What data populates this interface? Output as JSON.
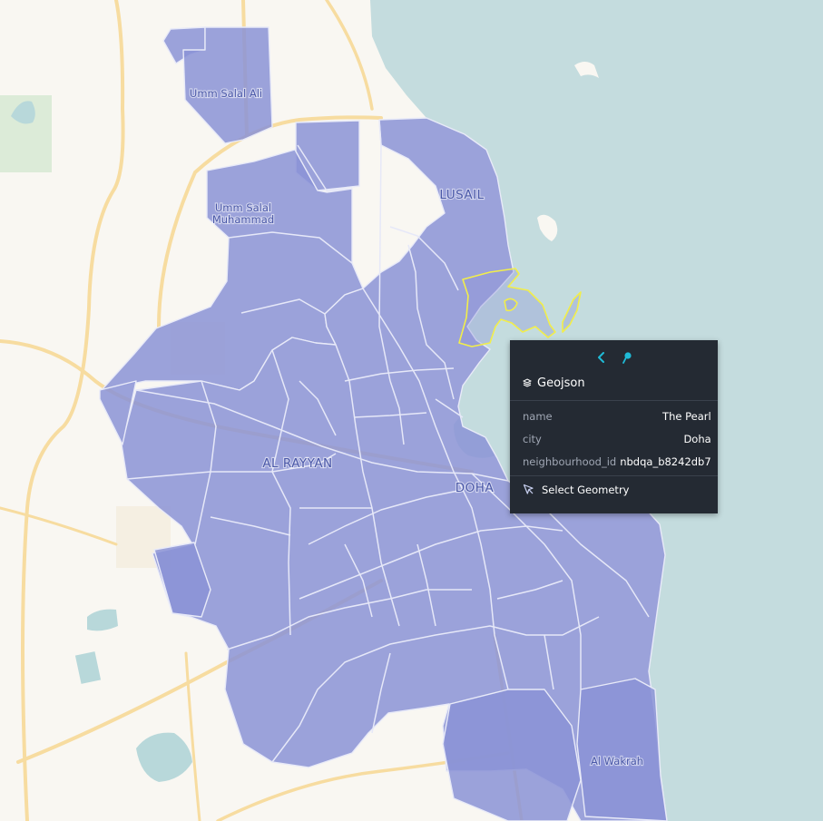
{
  "places": [
    {
      "id": "umm-salal-ali",
      "label": "Umm Salal Ali"
    },
    {
      "id": "umm-salal-muhammad-1",
      "label": "Umm Salal"
    },
    {
      "id": "umm-salal-muhammad-2",
      "label": "Muhammad"
    },
    {
      "id": "lusail",
      "label": "LUSAIL"
    },
    {
      "id": "al-rayyan",
      "label": "AL RAYYAN"
    },
    {
      "id": "doha",
      "label": "DOHA"
    },
    {
      "id": "al-wakrah",
      "label": "Al Wakrah"
    }
  ],
  "colors": {
    "land": "#f9f7f2",
    "water": "#c4dcde",
    "road": "#f7dca0",
    "region_fill": "#8b93d6",
    "region_border": "#e8eaf8",
    "highlight": "#f2ee4a",
    "park": "#dcebd8",
    "popup_bg": "#242a33",
    "accent": "#1fbad6"
  },
  "popup": {
    "nav_back_icon": "chevron-left-icon",
    "nav_pin_icon": "pin-icon",
    "layer_icon": "layers-icon",
    "layer_name": "Geojson",
    "fields": [
      {
        "key": "name",
        "value": "The Pearl"
      },
      {
        "key": "city",
        "value": "Doha"
      },
      {
        "key": "neighbourhood_id",
        "value": "nbdqa_b8242db7"
      }
    ],
    "action_icon": "cursor-arrow-icon",
    "action_label": "Select Geometry"
  }
}
